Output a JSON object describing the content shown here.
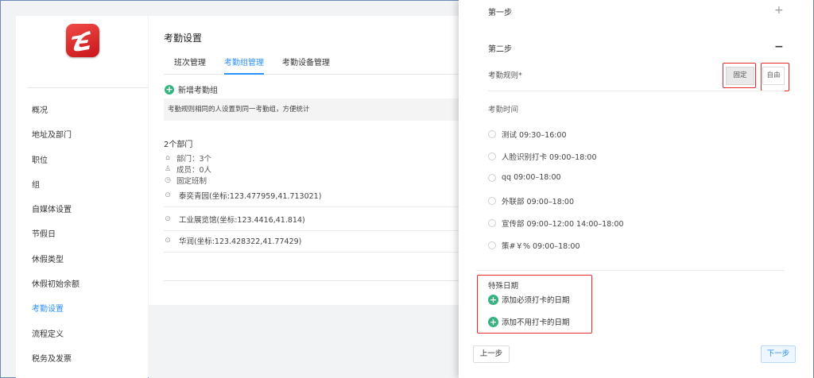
{
  "sidebar": {
    "logo_icon": "app-logo",
    "items": [
      {
        "label": "概况"
      },
      {
        "label": "地址及部门"
      },
      {
        "label": "职位"
      },
      {
        "label": "组"
      },
      {
        "label": "自媒体设置"
      },
      {
        "label": "节假日"
      },
      {
        "label": "休假类型"
      },
      {
        "label": "休假初始余额"
      },
      {
        "label": "考勤设置",
        "active": true
      },
      {
        "label": "流程定义"
      },
      {
        "label": "税务及发票"
      }
    ]
  },
  "main": {
    "title": "考勤设置",
    "tabs": [
      {
        "label": "班次管理"
      },
      {
        "label": "考勤组管理",
        "active": true
      },
      {
        "label": "考勤设备管理"
      }
    ],
    "add_group_label": "新增考勤组",
    "hint": "考勤规则相同的人设置到同一考勤组，方便统计",
    "group": {
      "title": "2个部门",
      "departments": "部门：3个",
      "members": "成员：0人",
      "schedule": "固定班制",
      "locations": [
        "泰奕青园(坐标:123.477959,41.713021)",
        "工业展览馆(坐标:123.4416,41.814)",
        "华润(坐标:123.428322,41.77429)"
      ]
    }
  },
  "drawer": {
    "step1_label": "第一步",
    "step2_label": "第二步",
    "rule_label": "考勤规则*",
    "rule_fixed": "固定",
    "rule_free": "自由",
    "time_label": "考勤时间",
    "shifts": [
      "测试 09:30–16:00",
      "人脸识别打卡 09:00–18:00",
      "qq 09:00–18:00",
      "外联部 09:00–18:00",
      "宣传部 09:00–12:00 14:00–18:00",
      "策#￥% 09:00–18:00"
    ],
    "special_title": "特殊日期",
    "add_required": "添加必须打卡的日期",
    "add_not_required": "添加不用打卡的日期",
    "prev_label": "上一步",
    "next_label": "下一步"
  },
  "colors": {
    "accent": "#2a8ff7",
    "add_green": "#36b37e",
    "highlight_red": "#e52a2a"
  }
}
